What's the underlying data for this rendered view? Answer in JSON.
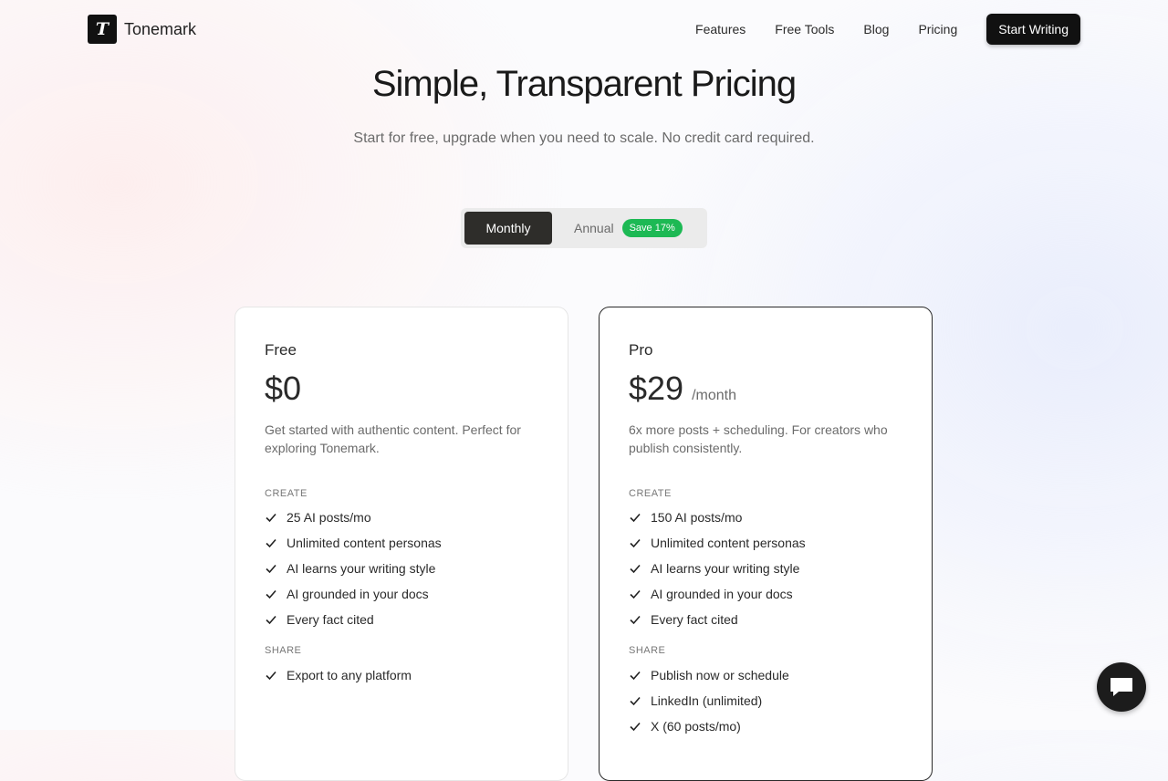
{
  "header": {
    "logo_letter": "T",
    "brand": "Tonemark",
    "nav": [
      "Features",
      "Free Tools",
      "Blog",
      "Pricing"
    ],
    "cta": "Start Writing"
  },
  "hero": {
    "title": "Simple, Transparent Pricing",
    "subtitle": "Start for free, upgrade when you need to scale. No credit card required."
  },
  "billing_toggle": {
    "monthly": "Monthly",
    "annual": "Annual",
    "annual_badge": "Save 17%",
    "selected": "Monthly"
  },
  "plans": [
    {
      "name": "Free",
      "price": "$0",
      "period": "",
      "description": "Get started with authentic content. Perfect for exploring Tonemark.",
      "sections": [
        {
          "title": "CREATE",
          "features": [
            "25 AI posts/mo",
            "Unlimited content personas",
            "AI learns your writing style",
            "AI grounded in your docs",
            "Every fact cited"
          ]
        },
        {
          "title": "SHARE",
          "features": [
            "Export to any platform"
          ]
        }
      ]
    },
    {
      "name": "Pro",
      "price": "$29",
      "period": "/month",
      "description": "6x more posts + scheduling. For creators who publish consistently.",
      "sections": [
        {
          "title": "CREATE",
          "features": [
            "150 AI posts/mo",
            "Unlimited content personas",
            "AI learns your writing style",
            "AI grounded in your docs",
            "Every fact cited"
          ]
        },
        {
          "title": "SHARE",
          "features": [
            "Publish now or schedule",
            "LinkedIn (unlimited)",
            "X (60 posts/mo)"
          ]
        }
      ]
    }
  ],
  "colors": {
    "primary": "#111111",
    "badge": "#1db954",
    "muted_text": "#6b6b6b"
  },
  "icons": {
    "feature": "check-icon",
    "chat": "chat-bubble-icon"
  }
}
